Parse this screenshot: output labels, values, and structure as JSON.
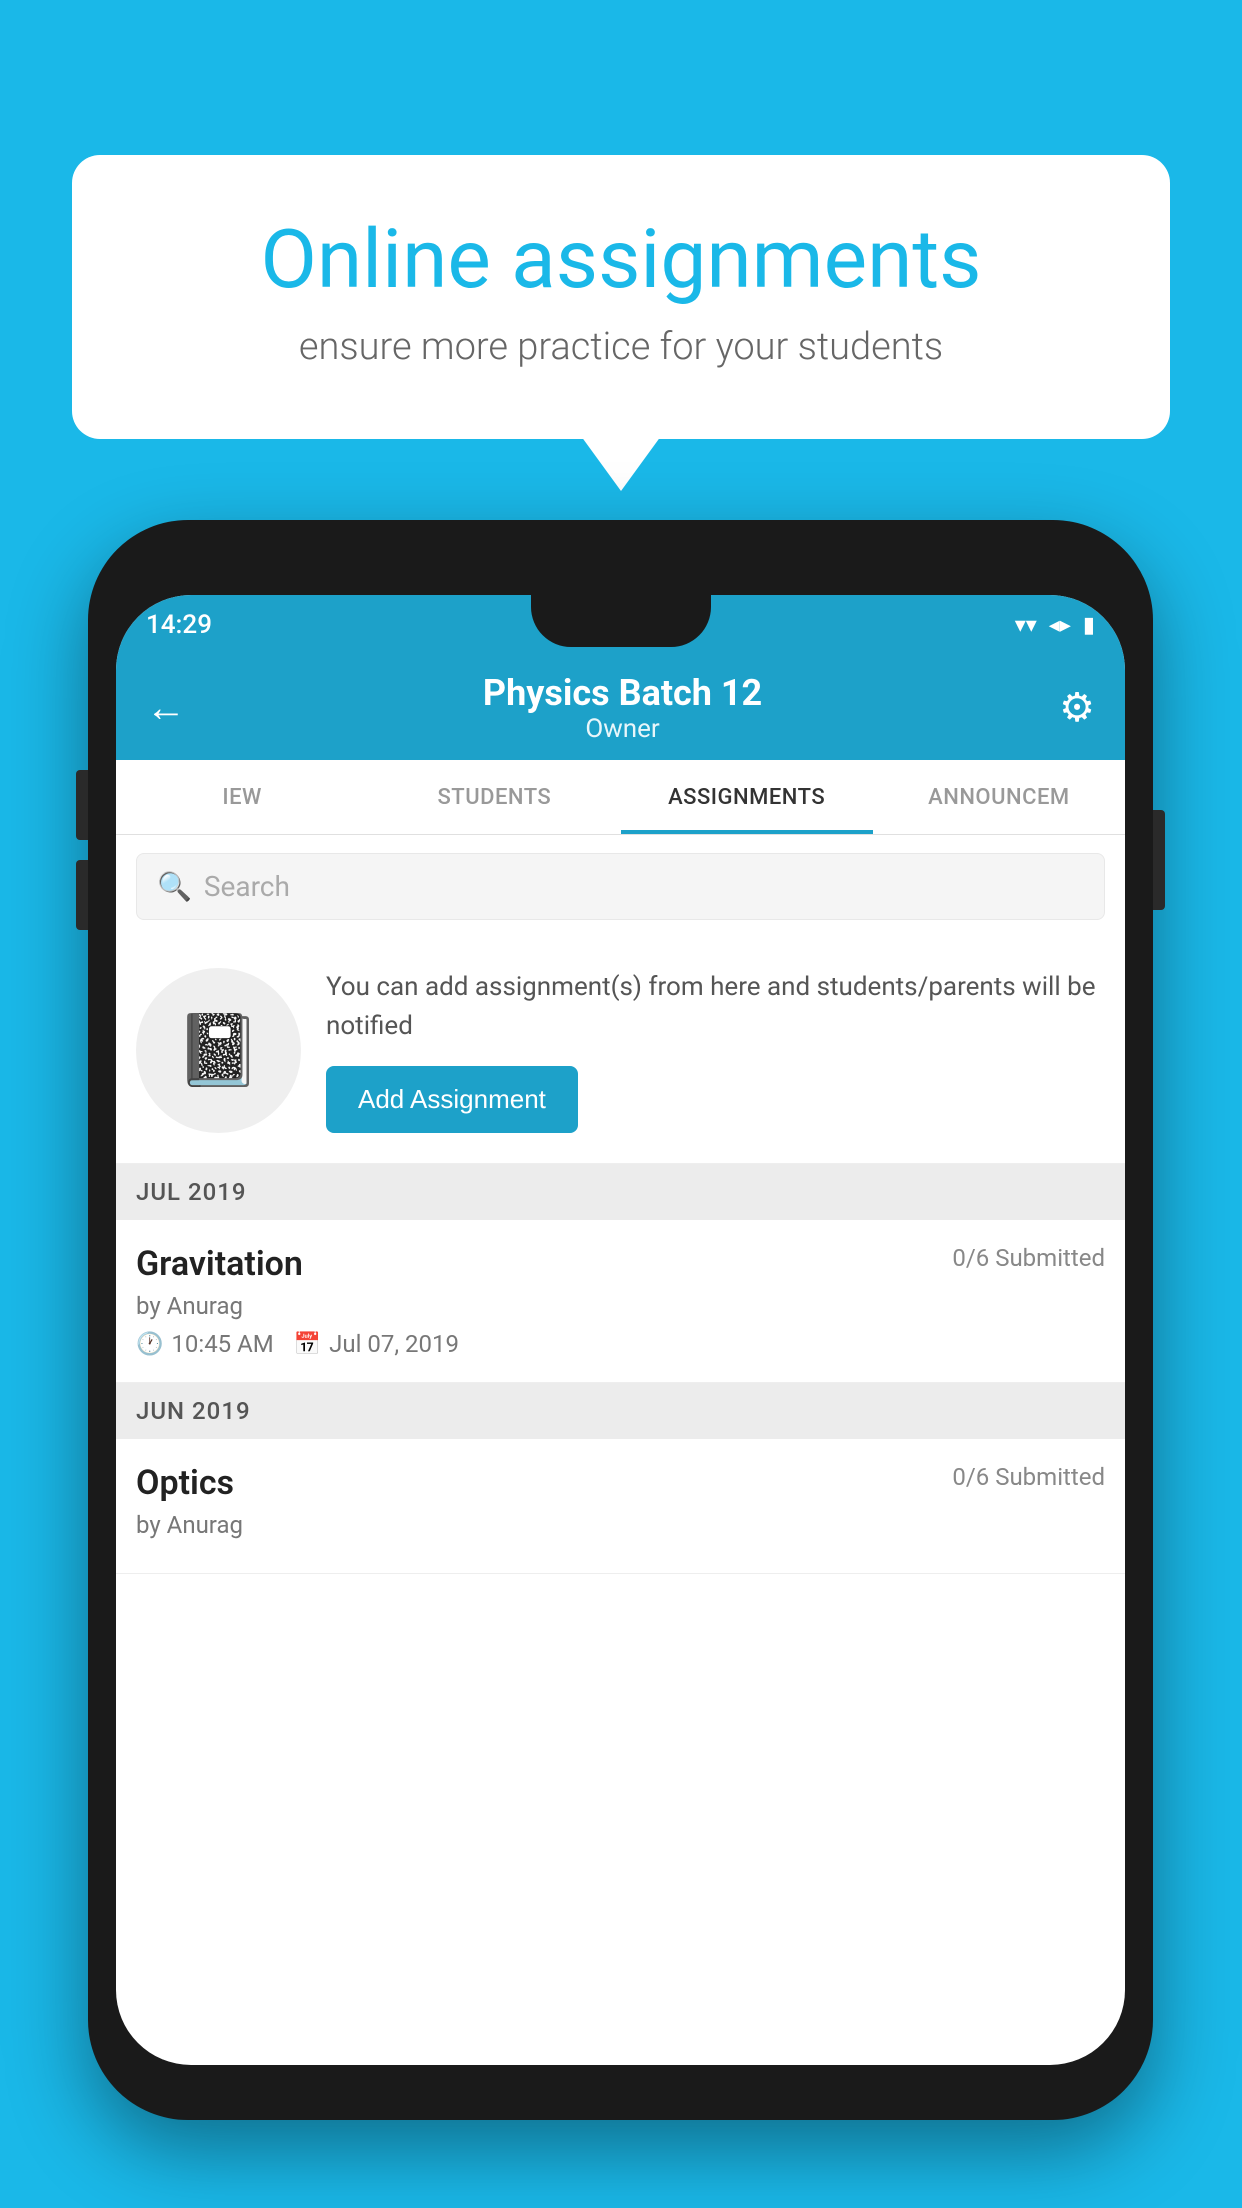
{
  "background_color": "#1ab8e8",
  "speech_bubble": {
    "title": "Online assignments",
    "subtitle": "ensure more practice for your students"
  },
  "status_bar": {
    "time": "14:29",
    "wifi": "▼",
    "signal": "▲",
    "battery": "▮"
  },
  "app_bar": {
    "title": "Physics Batch 12",
    "subtitle": "Owner",
    "back_label": "←",
    "settings_label": "⚙"
  },
  "tabs": [
    {
      "label": "IEW",
      "active": false
    },
    {
      "label": "STUDENTS",
      "active": false
    },
    {
      "label": "ASSIGNMENTS",
      "active": true
    },
    {
      "label": "ANNOUNCEM",
      "active": false
    }
  ],
  "search": {
    "placeholder": "Search"
  },
  "promo": {
    "text": "You can add assignment(s) from here and students/parents will be notified",
    "button_label": "Add Assignment"
  },
  "sections": [
    {
      "month": "JUL 2019",
      "assignments": [
        {
          "title": "Gravitation",
          "submitted": "0/6 Submitted",
          "author": "by Anurag",
          "time": "10:45 AM",
          "date": "Jul 07, 2019"
        }
      ]
    },
    {
      "month": "JUN 2019",
      "assignments": [
        {
          "title": "Optics",
          "submitted": "0/6 Submitted",
          "author": "by Anurag",
          "time": "",
          "date": ""
        }
      ]
    }
  ]
}
